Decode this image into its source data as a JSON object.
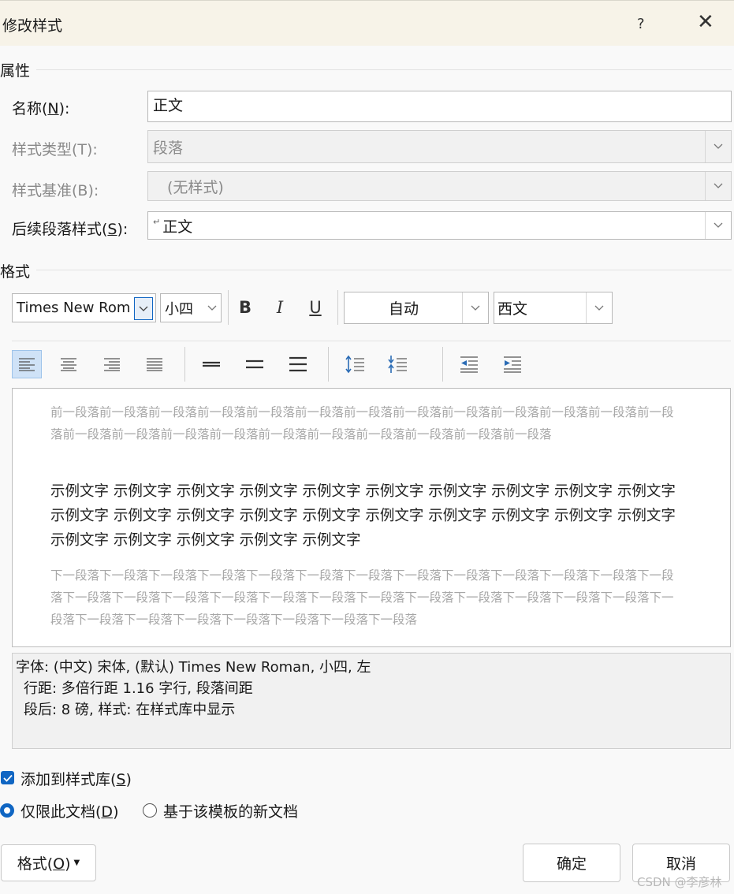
{
  "window": {
    "title": "修改样式",
    "help": "?",
    "close": "✕"
  },
  "properties": {
    "header": "属性",
    "name_label": "名称(N):",
    "name_value": "正文",
    "type_label": "样式类型(T):",
    "type_value": "段落",
    "base_label": "样式基准(B):",
    "base_value": "(无样式)",
    "next_label": "后续段落样式(S):",
    "next_value": "正文",
    "next_marker": "↵"
  },
  "format": {
    "header": "格式",
    "font": "Times New Rom",
    "size": "小四",
    "bold": "B",
    "italic": "I",
    "underline": "U",
    "color": "自动",
    "script": "西文"
  },
  "preview": {
    "prev_para": "前一段落前一段落前一段落前一段落前一段落前一段落前一段落前一段落前一段落前一段落前一段落前一段落前一段落前一段落前一段落前一段落前一段落前一段落前一段落前一段落前一段落前一段落前一段落",
    "sample": "示例文字 示例文字 示例文字 示例文字 示例文字 示例文字 示例文字 示例文字 示例文字 示例文字 示例文字 示例文字 示例文字 示例文字 示例文字 示例文字 示例文字 示例文字 示例文字 示例文字 示例文字 示例文字 示例文字 示例文字 示例文字",
    "next_para": "下一段落下一段落下一段落下一段落下一段落下一段落下一段落下一段落下一段落下一段落下一段落下一段落下一段落下一段落下一段落下一段落下一段落下一段落下一段落下一段落下一段落下一段落下一段落下一段落下一段落下一段落下一段落下一段落下一段落下一段落下一段落下一段落下一段落"
  },
  "description": {
    "line1": "字体: (中文) 宋体, (默认) Times New Roman, 小四, 左",
    "line2": "行距: 多倍行距 1.16 字行, 段落间距",
    "line3": "段后: 8 磅, 样式: 在样式库中显示"
  },
  "options": {
    "add_to_gallery": "添加到样式库(S)",
    "this_doc_only": "仅限此文档(D)",
    "new_docs": "基于该模板的新文档"
  },
  "buttons": {
    "format": "格式(O)",
    "ok": "确定",
    "cancel": "取消"
  },
  "watermark": "CSDN @李彦林",
  "colors": {
    "accent": "#1066c3",
    "titlebar": "#f7f3e8"
  }
}
